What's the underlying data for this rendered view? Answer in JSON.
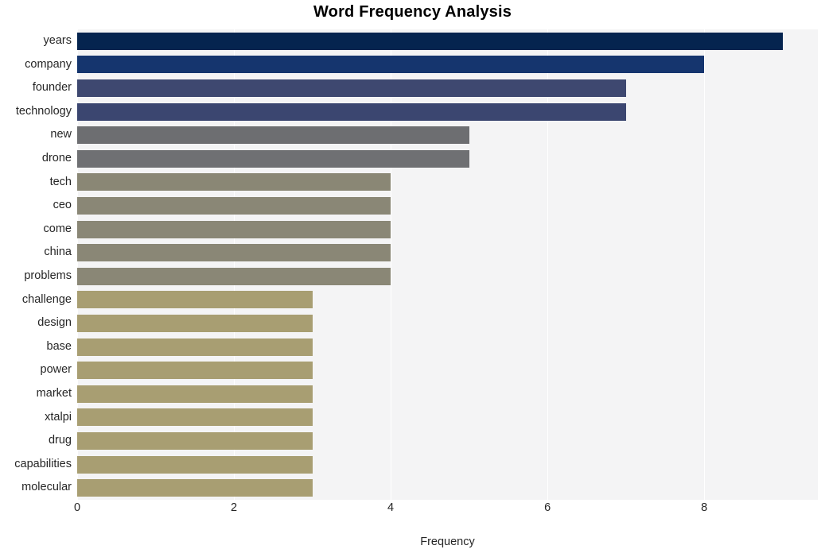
{
  "chart_data": {
    "type": "bar",
    "orientation": "horizontal",
    "title": "Word Frequency Analysis",
    "xlabel": "Frequency",
    "ylabel": "",
    "xlim": [
      0,
      9.45
    ],
    "xticks": [
      0,
      2,
      4,
      6,
      8
    ],
    "xtick_labels": [
      "0",
      "2",
      "4",
      "6",
      "8"
    ],
    "grid": true,
    "legend": "none",
    "categories": [
      "years",
      "company",
      "founder",
      "technology",
      "new",
      "drone",
      "tech",
      "ceo",
      "come",
      "china",
      "problems",
      "challenge",
      "design",
      "base",
      "power",
      "market",
      "xtalpi",
      "drug",
      "capabilities",
      "molecular"
    ],
    "values": [
      9,
      8,
      7,
      7,
      5,
      5,
      4,
      4,
      4,
      4,
      4,
      3,
      3,
      3,
      3,
      3,
      3,
      3,
      3,
      3
    ],
    "bar_colors": [
      "#05244f",
      "#15356e",
      "#3e4870",
      "#3b4670",
      "#6d6e71",
      "#6f7073",
      "#8a8775",
      "#8a8776",
      "#8a8776",
      "#8a8776",
      "#8a8776",
      "#a89e72",
      "#a89e72",
      "#a89e72",
      "#a89e72",
      "#a89e72",
      "#a89e72",
      "#a89e72",
      "#a89e72",
      "#a89e72"
    ],
    "plot_background": "#f4f4f5",
    "figure_background": "#ffffff",
    "gridline_color": "#ffffff",
    "text_color": "#262626"
  }
}
